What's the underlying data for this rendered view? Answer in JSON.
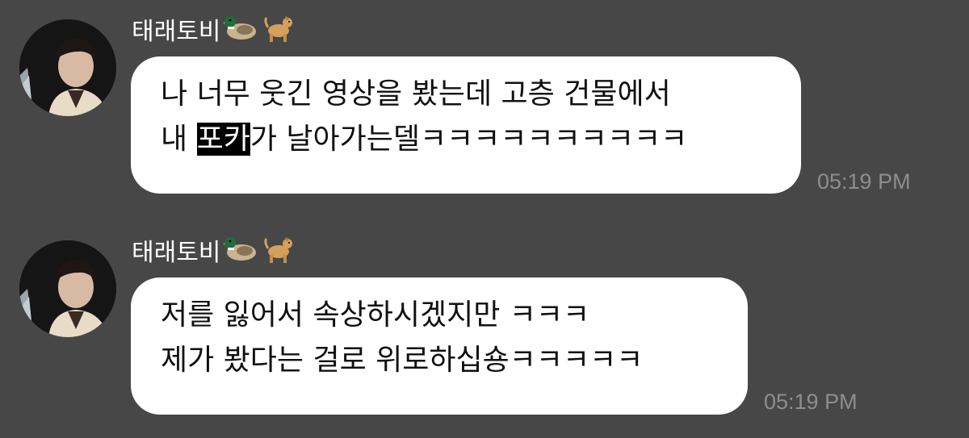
{
  "messages": [
    {
      "sender": "태래토비",
      "sender_emojis": [
        "duck-icon",
        "dog-icon"
      ],
      "line1": "나 너무 웃긴 영상을 봤는데 고층 건물에서",
      "line2_before": "내 ",
      "line2_highlight": "포카",
      "line2_after": "가 날아가는델ㅋㅋㅋㅋㅋㅋㅋㅋㅋㅋ",
      "time": "05:19 PM"
    },
    {
      "sender": "태래토비",
      "sender_emojis": [
        "duck-icon",
        "dog-icon"
      ],
      "line1": "저를 잃어서 속상하시겠지만 ㅋㅋㅋ",
      "line2": "제가 봤다는 걸로 위로하십숑ㅋㅋㅋㅋㅋ",
      "time": "05:19 PM"
    }
  ],
  "colors": {
    "background": "#474747",
    "bubble": "#ffffff",
    "text": "#111111",
    "timestamp": "#8e8e8e",
    "highlight_bg": "#000000",
    "highlight_text": "#ffffff"
  }
}
